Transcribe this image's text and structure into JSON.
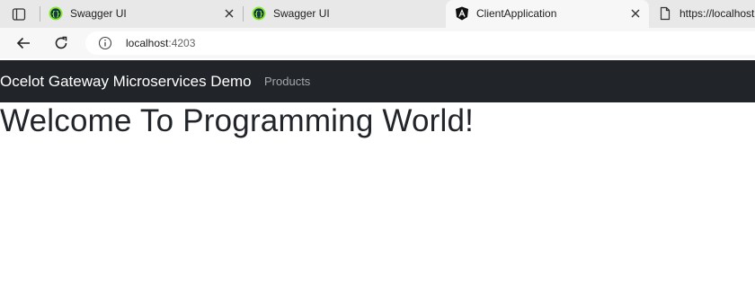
{
  "browser": {
    "tabs": [
      {
        "title": "Swagger UI",
        "favicon": "swagger-icon",
        "active": false
      },
      {
        "title": "Swagger UI",
        "favicon": "swagger-icon",
        "active": false
      },
      {
        "title": "ClientApplication",
        "favicon": "angular-icon",
        "active": true
      },
      {
        "title": "https://localhost",
        "favicon": "page-icon",
        "active": false
      }
    ],
    "address": {
      "host": "localhost",
      "port": ":4203"
    }
  },
  "navbar": {
    "brand": "Ocelot Gateway Microservices Demo",
    "links": [
      "Products"
    ]
  },
  "main": {
    "heading": "Welcome To Programming World!"
  },
  "colors": {
    "navbar_bg": "#212529",
    "swagger_green": "#85ea2d",
    "tabstrip_bg": "#e8e8e8"
  }
}
